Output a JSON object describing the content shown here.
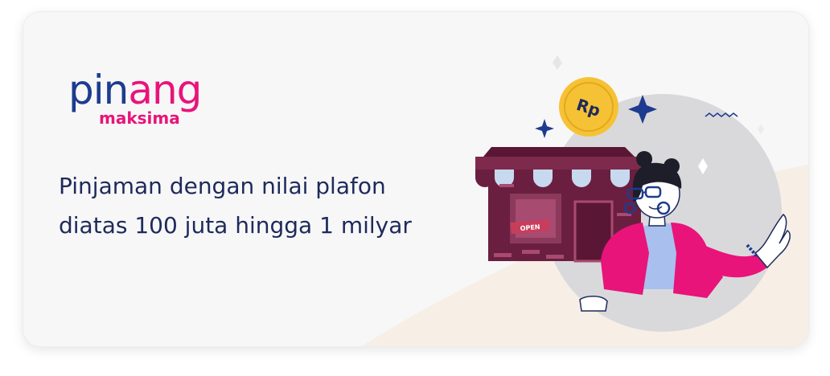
{
  "logo": {
    "brand_part1": "pin",
    "brand_part2": "ang",
    "sub": "maksima"
  },
  "headline": "Pinjaman dengan nilai plafon diatas 100 juta hingga 1 milyar",
  "illustration": {
    "coin_label": "Rp",
    "sign_label": "OPEN"
  },
  "colors": {
    "navy": "#1d3c8f",
    "magenta": "#e8147a",
    "maroon": "#6b1f40",
    "gold": "#f6c235",
    "card_bg": "#f7f7f8"
  }
}
